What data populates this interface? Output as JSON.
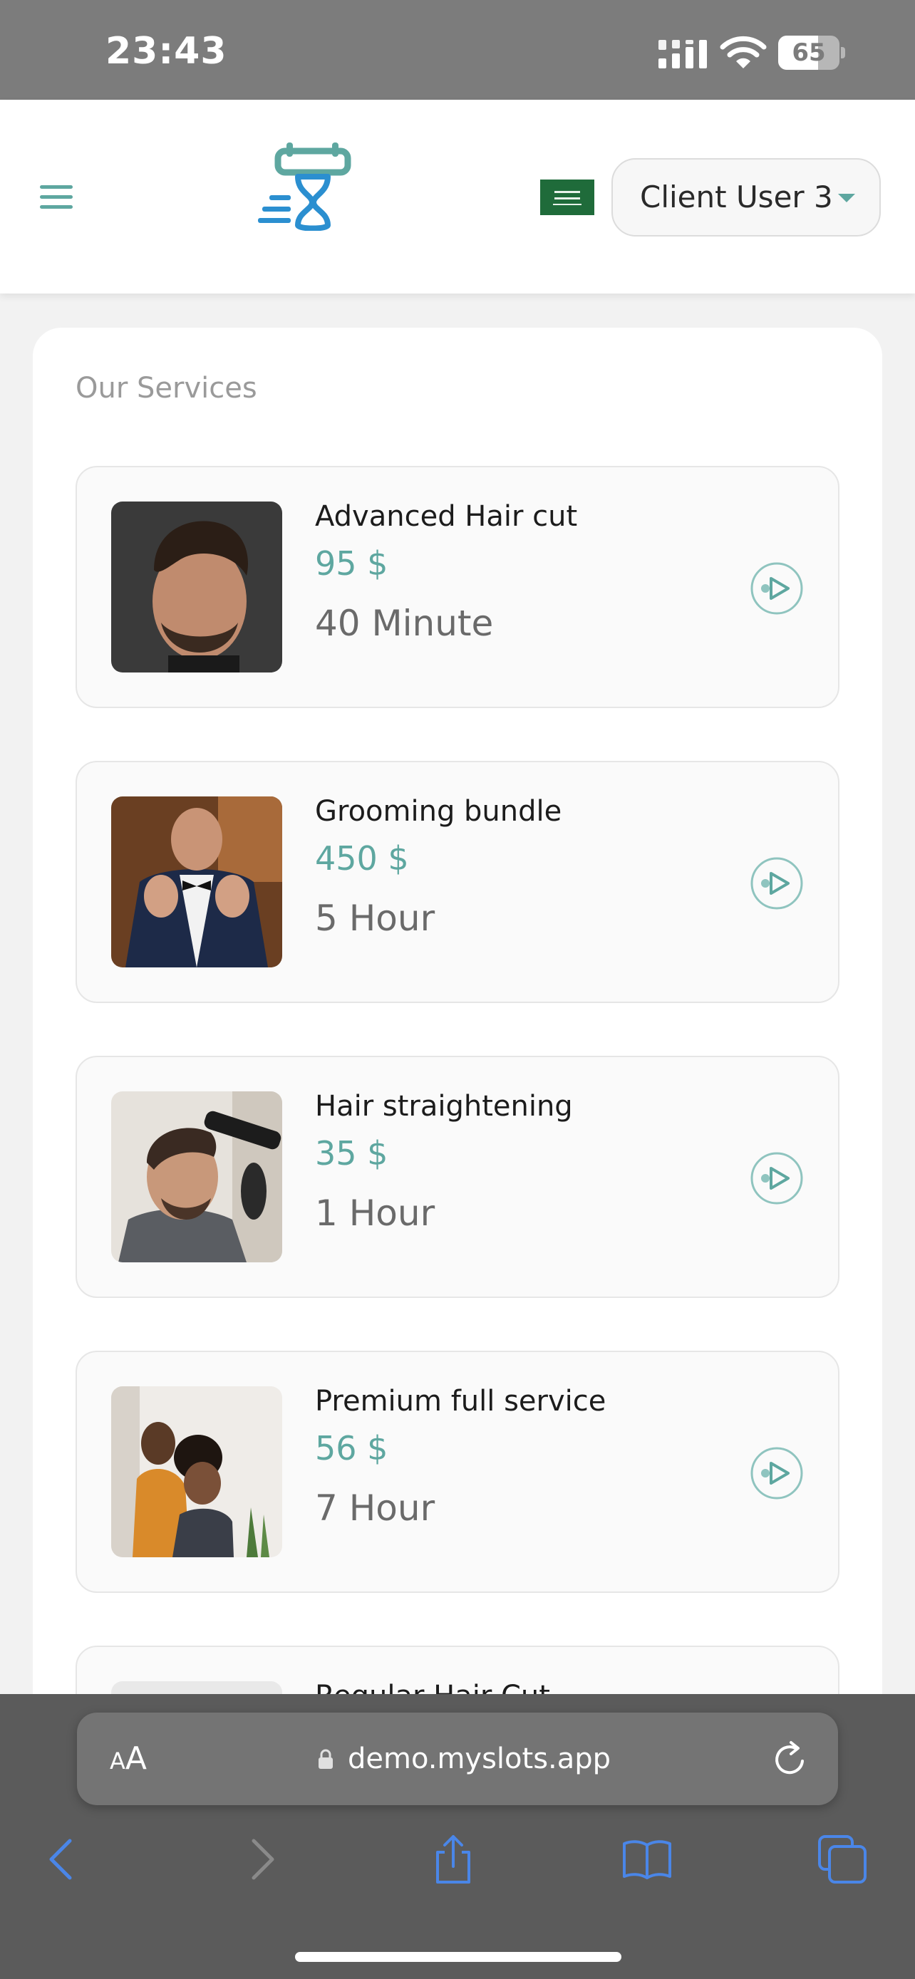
{
  "status_bar": {
    "time": "23:43",
    "battery": "65",
    "battery_level": 0.65
  },
  "header": {
    "user_name": "Client User 3",
    "flag_icon": "saudi-arabia-flag-icon",
    "accent_color": "#5ea7a0"
  },
  "main": {
    "section_title": "Our Services",
    "services": [
      {
        "name": "Advanced Hair cut",
        "price": "95 $",
        "duration": "40 Minute"
      },
      {
        "name": "Grooming bundle",
        "price": "450 $",
        "duration": "5 Hour"
      },
      {
        "name": "Hair straightening",
        "price": "35 $",
        "duration": "1 Hour"
      },
      {
        "name": "Premium full service",
        "price": "56 $",
        "duration": "7 Hour"
      },
      {
        "name": "Regular Hair Cut"
      }
    ]
  },
  "browser": {
    "text_size_small": "A",
    "text_size_big": "A",
    "url": "demo.myslots.app",
    "icons": [
      "back-icon",
      "forward-icon",
      "share-icon",
      "bookmarks-icon",
      "tabs-icon"
    ]
  }
}
